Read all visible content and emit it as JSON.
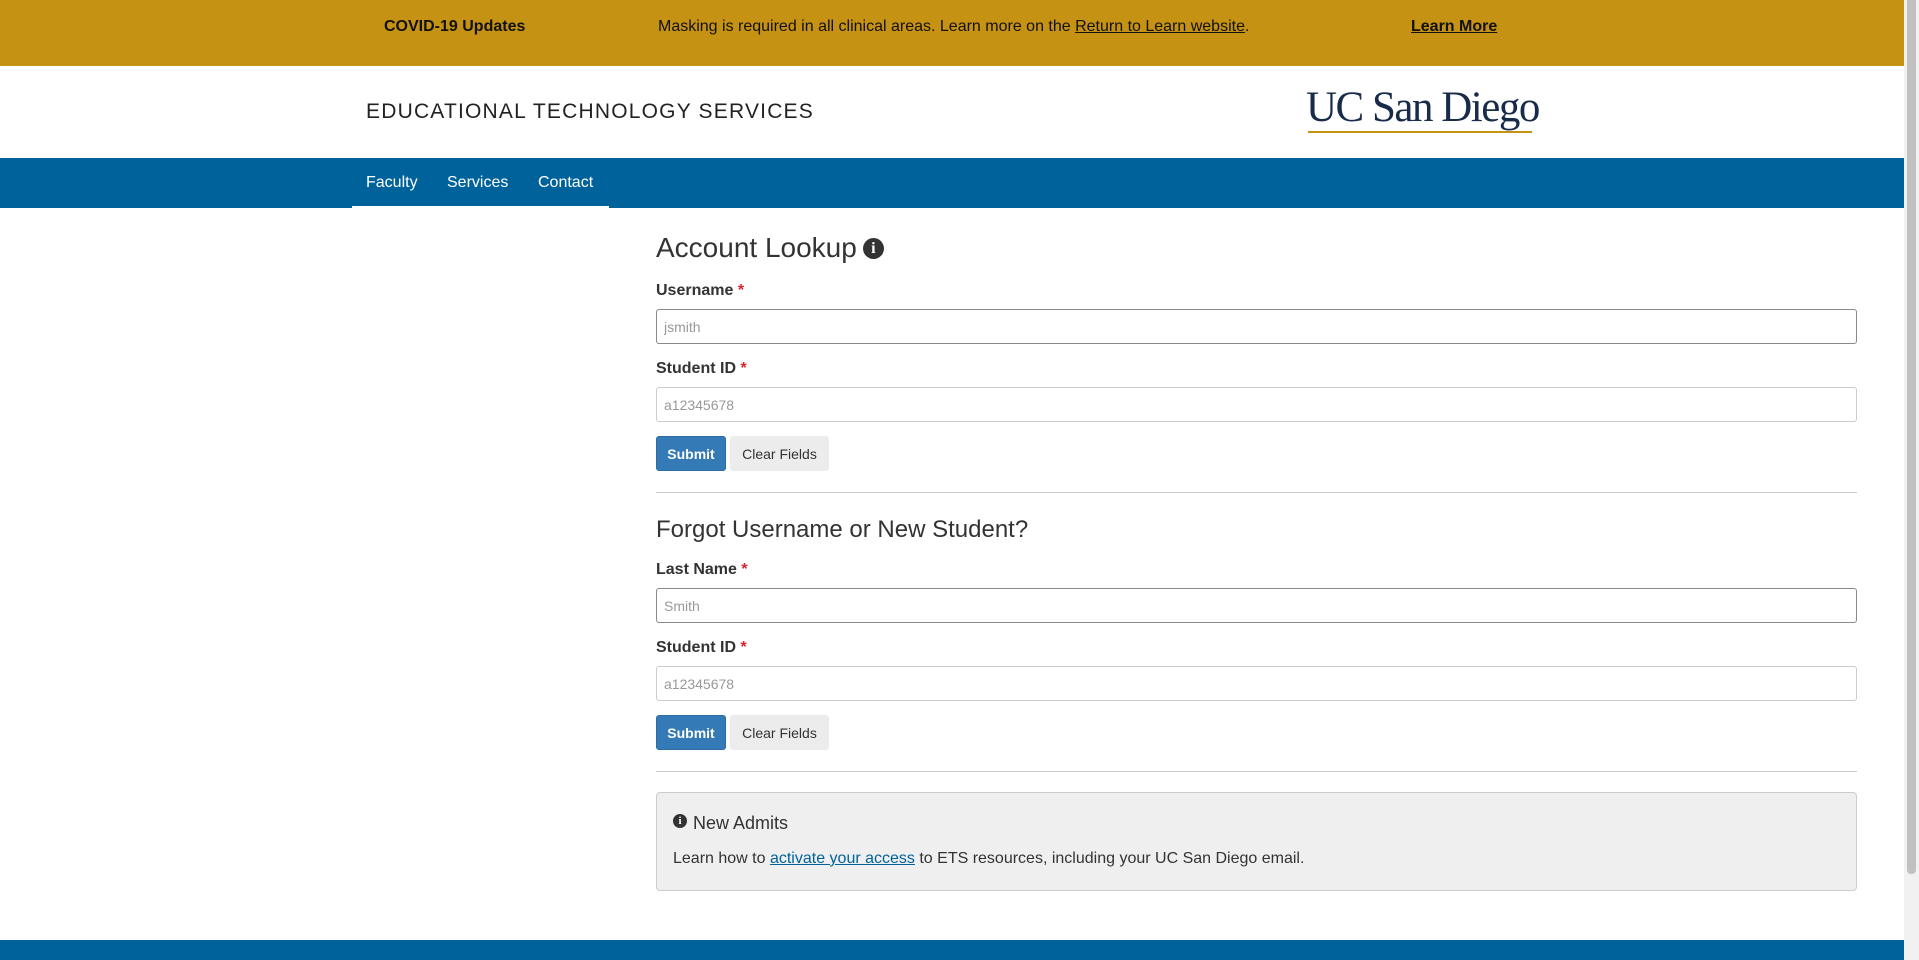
{
  "alert": {
    "title": "COVID-19 Updates",
    "message_before": "Masking is required in all clinical areas. Learn more on the ",
    "message_link": "Return to Learn website",
    "message_after": ".",
    "cta": "Learn More",
    "background_color": "#C69214"
  },
  "header": {
    "site_title": "EDUCATIONAL TECHNOLOGY SERVICES",
    "logo_text": "UC San Diego",
    "logo_color": "#182B49"
  },
  "nav": {
    "items": [
      {
        "label": "Faculty"
      },
      {
        "label": "Services"
      },
      {
        "label": "Contact"
      }
    ],
    "background_color": "#00629B"
  },
  "account_lookup": {
    "heading": "Account Lookup",
    "username_label": "Username",
    "username_placeholder": "jsmith",
    "student_id_label": "Student ID",
    "student_id_placeholder": "a12345678",
    "submit_label": "Submit",
    "clear_label": "Clear Fields"
  },
  "forgot": {
    "heading": "Forgot Username or New Student?",
    "last_name_label": "Last Name",
    "last_name_placeholder": "Smith",
    "student_id_label": "Student ID",
    "student_id_placeholder": "a12345678",
    "submit_label": "Submit",
    "clear_label": "Clear Fields"
  },
  "new_admits": {
    "title": "New Admits",
    "text_before": "Learn how to ",
    "link_text": "activate your access",
    "text_after": " to ETS resources, including your UC San Diego email."
  },
  "required_marker": "*",
  "info_glyph": "i",
  "icons": {
    "heading_info": "info-circle-icon",
    "well_info": "info-circle-icon"
  }
}
